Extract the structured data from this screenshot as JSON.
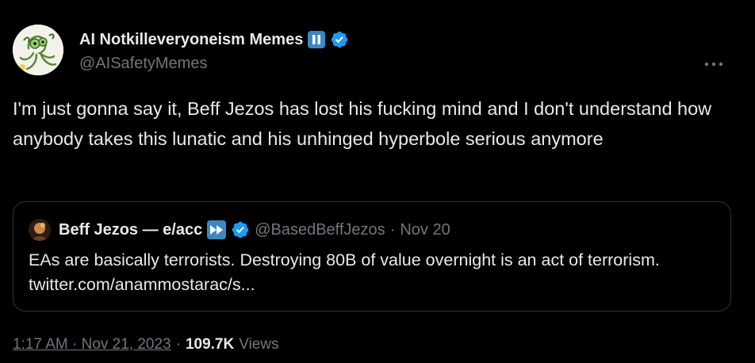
{
  "author": {
    "display_name": "AI Notkilleveryoneism Memes",
    "handle": "@AISafetyMemes",
    "avatar_icon": "cartoon-octopus-avatar",
    "badges": [
      "pause-icon",
      "verified-icon"
    ]
  },
  "tweet": {
    "text": "I'm just gonna say it, Beff Jezos has lost his fucking mind and I don't understand how anybody takes this lunatic and his unhinged hyperbole serious anymore"
  },
  "quoted": {
    "display_name": "Beff Jezos — e/acc",
    "handle": "@BasedBeffJezos",
    "separator": "·",
    "date": "Nov 20",
    "text": "EAs are basically terrorists. Destroying 80B of value overnight is an act of terrorism. twitter.com/anammostarac/s...",
    "badges": [
      "fast-forward-icon",
      "verified-icon"
    ]
  },
  "meta": {
    "timestamp": "1:17 AM · Nov 21, 2023",
    "separator": "·",
    "views_count": "109.7K",
    "views_label": "Views"
  },
  "colors": {
    "background": "#000000",
    "text_primary": "#e7e9ea",
    "text_secondary": "#71767b",
    "verified_blue": "#1d9bf0",
    "emoji_blue": "#3b88c3",
    "border": "#2f3336"
  }
}
